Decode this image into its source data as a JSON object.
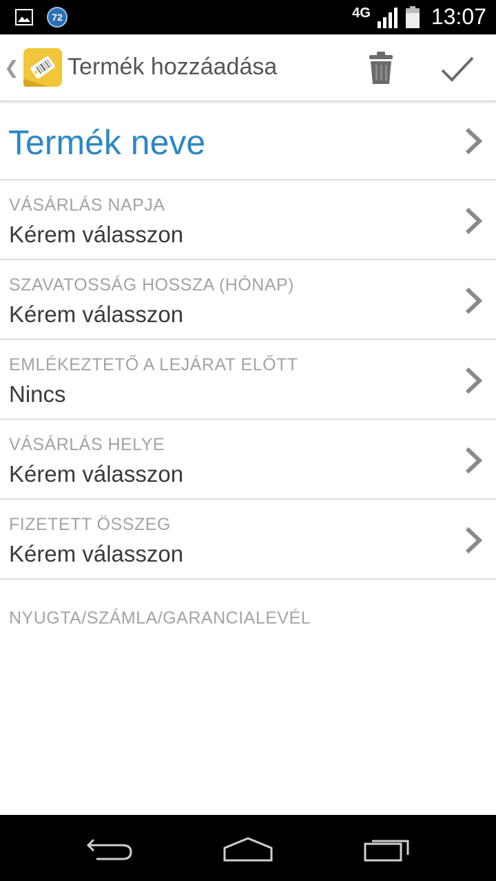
{
  "status_bar": {
    "notification_badge": "72",
    "network": "4G",
    "time": "13:07"
  },
  "action_bar": {
    "title": "Termék hozzáadása"
  },
  "form": {
    "product_name": "Termék neve",
    "fields": [
      {
        "label": "VÁSÁRLÁS NAPJA",
        "value": "Kérem válasszon"
      },
      {
        "label": "SZAVATOSSÁG HOSSZA (HÓNAP)",
        "value": "Kérem válasszon"
      },
      {
        "label": "EMLÉKEZTETŐ A LEJÁRAT ELŐTT",
        "value": "Nincs"
      },
      {
        "label": "VÁSÁRLÁS HELYE",
        "value": "Kérem válasszon"
      },
      {
        "label": "FIZETETT ÖSSZEG",
        "value": "Kérem válasszon"
      }
    ],
    "receipt_section": "NYUGTA/SZÁMLA/GARANCIALEVÉL"
  },
  "colors": {
    "accent": "#2a87c5",
    "label": "#a3a3a3",
    "value": "#3a3a3a",
    "divider": "#dcdcdc"
  },
  "icons": {
    "status_left": [
      "gallery-icon",
      "notification-badge-icon"
    ],
    "status_right": [
      "signal-icon",
      "battery-icon"
    ],
    "action_bar": [
      "back-caret-icon",
      "app-tag-icon",
      "trash-icon",
      "checkmark-icon"
    ],
    "row": "chevron-right-icon",
    "nav": [
      "back-icon",
      "home-icon",
      "recents-icon"
    ]
  }
}
